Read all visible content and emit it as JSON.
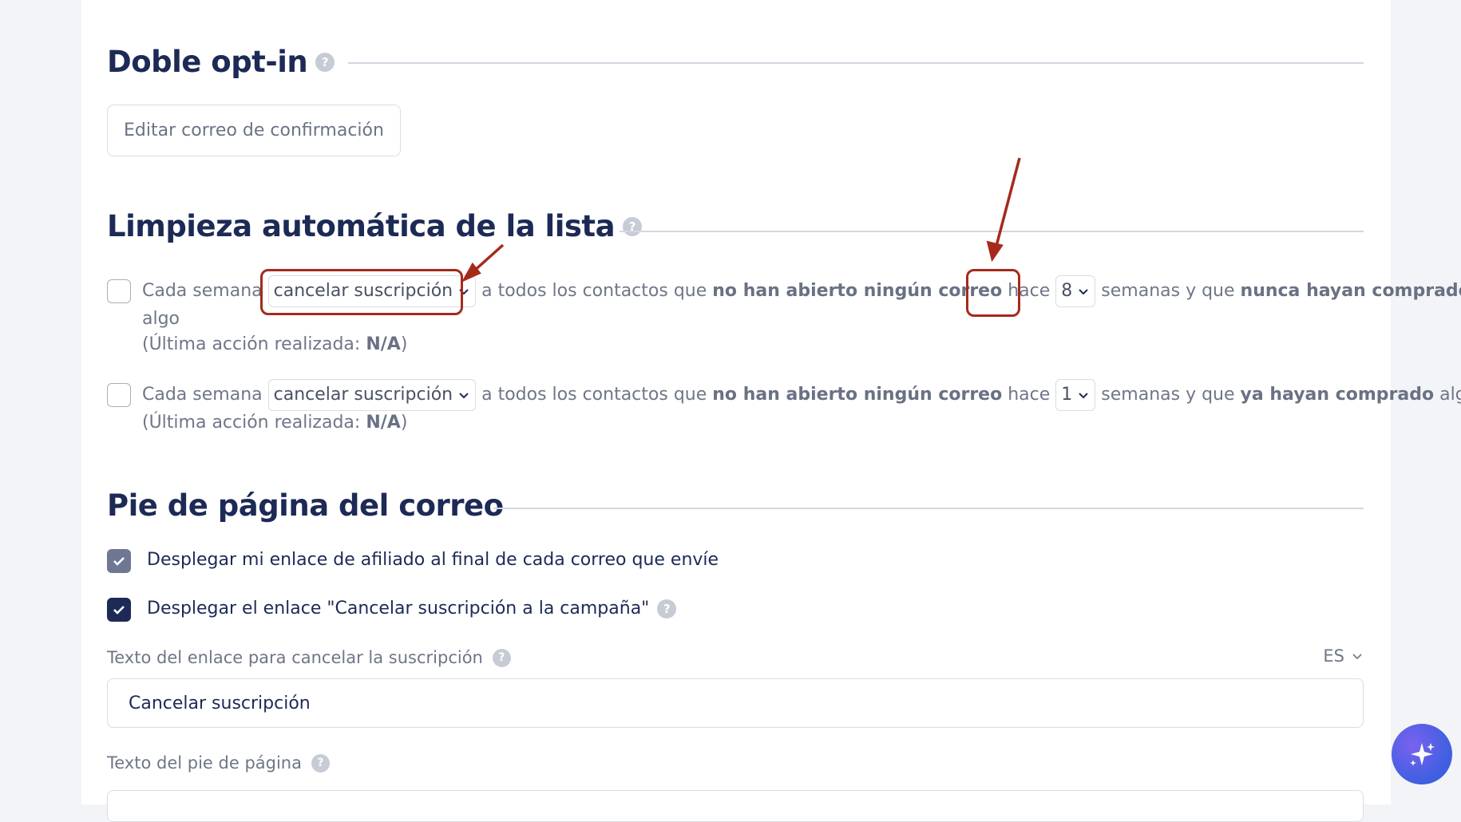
{
  "sections": {
    "double_optin": {
      "title": "Doble opt-in",
      "edit_button": "Editar correo de confirmación"
    },
    "list_cleaning": {
      "title": "Limpieza automática de la lista",
      "rule1": {
        "prefix": "Cada semana",
        "action": "cancelar suscripción",
        "mid": "a todos los contactos que",
        "condition": "no han abierto ningún correo",
        "hace": "hace",
        "weeks": "8",
        "suffix": "semanas y que",
        "purchase": "nunca hayan comprado",
        "tail": "algo",
        "last_action_label": "(Última acción realizada:",
        "last_action_value": "N/A",
        "last_action_close": ")"
      },
      "rule2": {
        "prefix": "Cada semana",
        "action": "cancelar suscripción",
        "mid": "a todos los contactos que",
        "condition": "no han abierto ningún correo",
        "hace": "hace",
        "weeks": "1",
        "suffix": "semanas y que",
        "purchase": "ya hayan comprado",
        "tail": "algo",
        "last_action_label": "(Última acción realizada:",
        "last_action_value": "N/A",
        "last_action_close": ")"
      }
    },
    "footer": {
      "title": "Pie de página del correo",
      "affiliate_label": "Desplegar mi enlace de afiliado al final de cada correo que envíe",
      "unsubscribe_label": "Desplegar el enlace \"Cancelar suscripción a la campaña\"",
      "unsub_text_label": "Texto del enlace para cancelar la suscripción",
      "language": "ES",
      "unsub_text_value": "Cancelar suscripción",
      "footer_text_label": "Texto del pie de página"
    }
  },
  "help_glyph": "?",
  "colors": {
    "primary": "#1c2a55",
    "annotation": "#a52a1c",
    "fab": "#4b5fe6"
  }
}
